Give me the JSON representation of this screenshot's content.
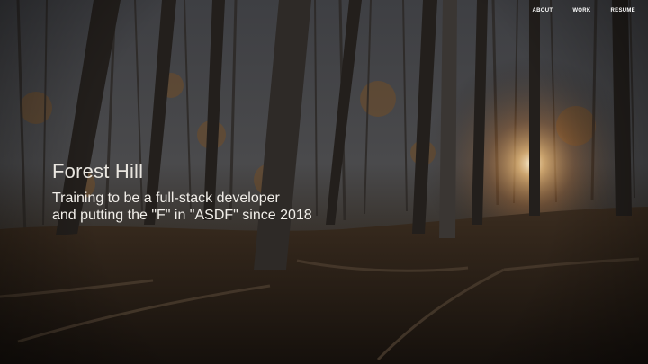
{
  "nav": {
    "items": [
      {
        "label": "ABOUT"
      },
      {
        "label": "WORK"
      },
      {
        "label": "RESUME"
      }
    ]
  },
  "hero": {
    "title": "Forest Hill",
    "tagline_line1": "Training to be a full-stack developer",
    "tagline_line2": "and putting the \"F\" in \"ASDF\" since 2018"
  },
  "colors": {
    "sky": "#44464a",
    "forest_floor": "#2a2119",
    "sun_glow": "#f2a24a",
    "text": "#ffffff"
  }
}
